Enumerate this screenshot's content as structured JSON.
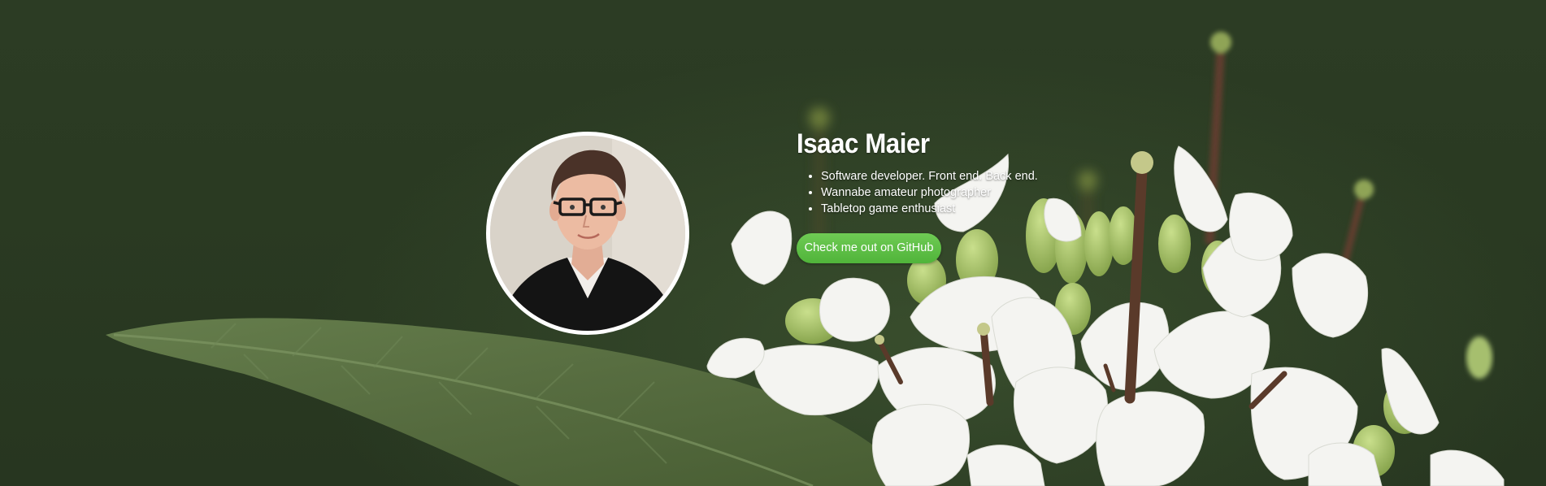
{
  "profile": {
    "name": "Isaac Maier",
    "bullets": [
      "Software developer. Front end. Back end.",
      "Wannabe amateur photographer",
      "Tabletop game enthusiast"
    ],
    "github_button": "Check me out on GitHub"
  },
  "colors": {
    "background": "#2a3a22",
    "button": "#5cbf44",
    "text": "#ffffff"
  }
}
